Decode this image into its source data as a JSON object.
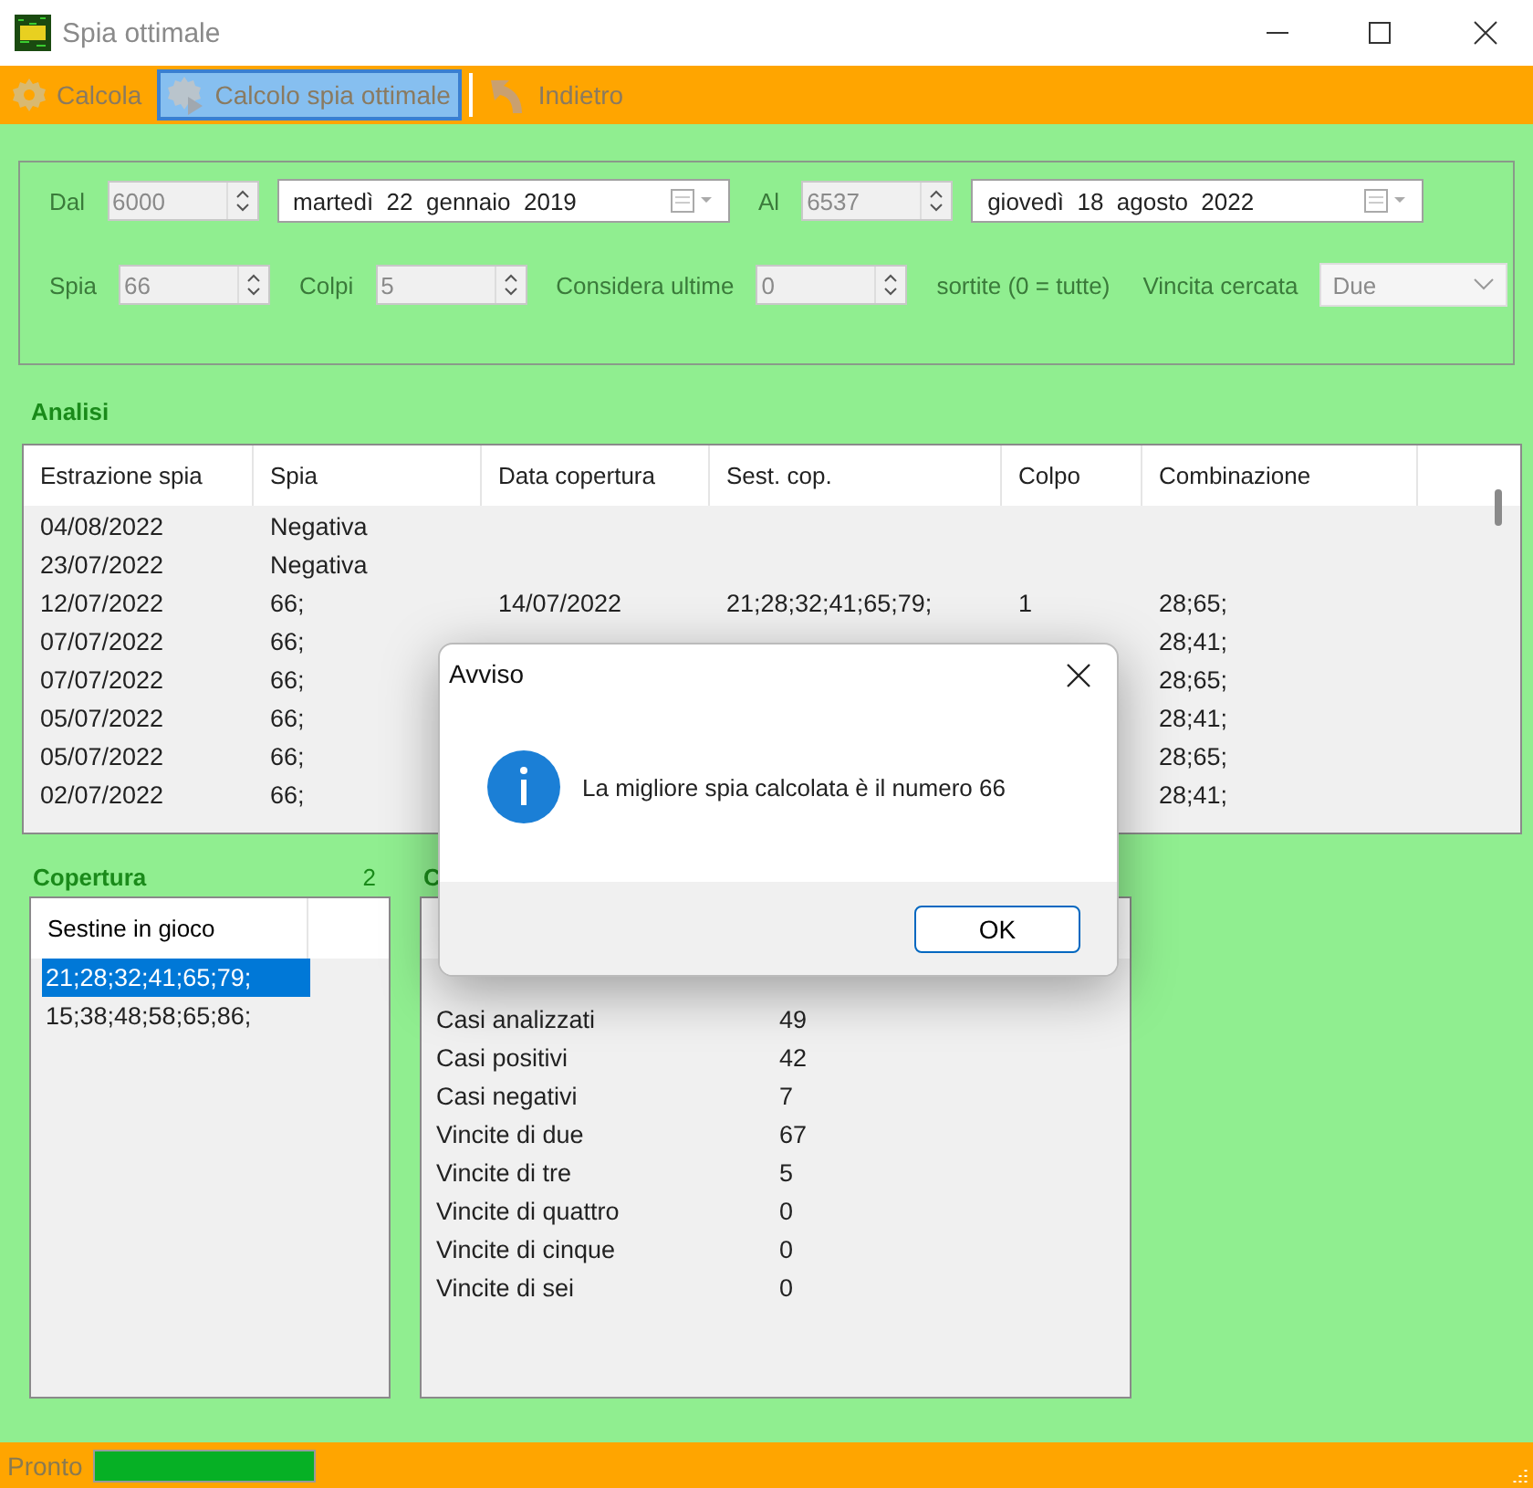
{
  "window": {
    "title": "Spia ottimale"
  },
  "toolbar": [
    {
      "label": "Calcola",
      "kind": "gear",
      "selected": false
    },
    {
      "label": "Calcolo spia ottimale",
      "kind": "gearplay",
      "selected": true
    },
    {
      "label": "Indietro",
      "kind": "back",
      "selected": false
    }
  ],
  "filters": [
    [
      {
        "kind": "label",
        "text": "Dal"
      },
      {
        "kind": "spinner",
        "value": "6000",
        "disabled": true
      },
      {
        "kind": "date",
        "value": "martedì  22  gennaio  2019"
      },
      {
        "kind": "label",
        "text": "Al"
      },
      {
        "kind": "spinner",
        "value": "6537",
        "disabled": true
      },
      {
        "kind": "date",
        "value": "giovedì  18  agosto  2022"
      }
    ],
    [
      {
        "kind": "label",
        "text": "Spia"
      },
      {
        "kind": "spinner",
        "value": "66",
        "disabled": true
      },
      {
        "kind": "label",
        "text": "Colpi"
      },
      {
        "kind": "spinner",
        "value": "5",
        "disabled": true
      },
      {
        "kind": "label",
        "text": "Considera ultime"
      },
      {
        "kind": "spinner",
        "value": "0",
        "disabled": true
      },
      {
        "kind": "label",
        "text": "sortite (0 = tutte)"
      },
      {
        "kind": "label",
        "text": "Vincita cercata"
      },
      {
        "kind": "dropdown",
        "value": "Due",
        "disabled": true
      }
    ]
  ],
  "analisi": {
    "title": "Analisi",
    "columns": [
      "Estrazione spia",
      "Spia",
      "Data copertura",
      "Sest. cop.",
      "Colpo",
      "Combinazione"
    ],
    "rows": [
      [
        "04/08/2022",
        "Negativa",
        null,
        null,
        null,
        null
      ],
      [
        "23/07/2022",
        "Negativa",
        null,
        null,
        null,
        null
      ],
      [
        "12/07/2022",
        "66;",
        "14/07/2022",
        "21;28;32;41;65;79;",
        "1",
        "28;65;"
      ],
      [
        "07/07/2022",
        "66;",
        null,
        null,
        null,
        "28;41;"
      ],
      [
        "07/07/2022",
        "66;",
        null,
        null,
        null,
        "28;65;"
      ],
      [
        "05/07/2022",
        "66;",
        null,
        null,
        null,
        "28;41;"
      ],
      [
        "05/07/2022",
        "66;",
        null,
        null,
        null,
        "28;65;"
      ],
      [
        "02/07/2022",
        "66;",
        null,
        null,
        null,
        "28;41;"
      ]
    ]
  },
  "copertura": {
    "title": "Copertura",
    "count": "2",
    "column": "Sestine in gioco",
    "items": [
      {
        "text": "21;28;32;41;65;79;",
        "selected": true
      },
      {
        "text": "15;38;48;58;65;86;",
        "selected": false
      }
    ]
  },
  "stats": {
    "title": "C",
    "rows": [
      {
        "label": "Casi analizzati",
        "value": "49"
      },
      {
        "label": "Casi positivi",
        "value": "42"
      },
      {
        "label": "Casi negativi",
        "value": "7"
      },
      {
        "label": "Vincite di due",
        "value": "67"
      },
      {
        "label": "Vincite di tre",
        "value": "5"
      },
      {
        "label": "Vincite di quattro",
        "value": "0"
      },
      {
        "label": "Vincite di cinque",
        "value": "0"
      },
      {
        "label": "Vincite di sei",
        "value": "0"
      }
    ]
  },
  "dialog": {
    "title": "Avviso",
    "message": "La migliore spia calcolata è il numero 66",
    "button": "OK"
  },
  "status_bar": {
    "text": "Pronto",
    "level": 1
  }
}
